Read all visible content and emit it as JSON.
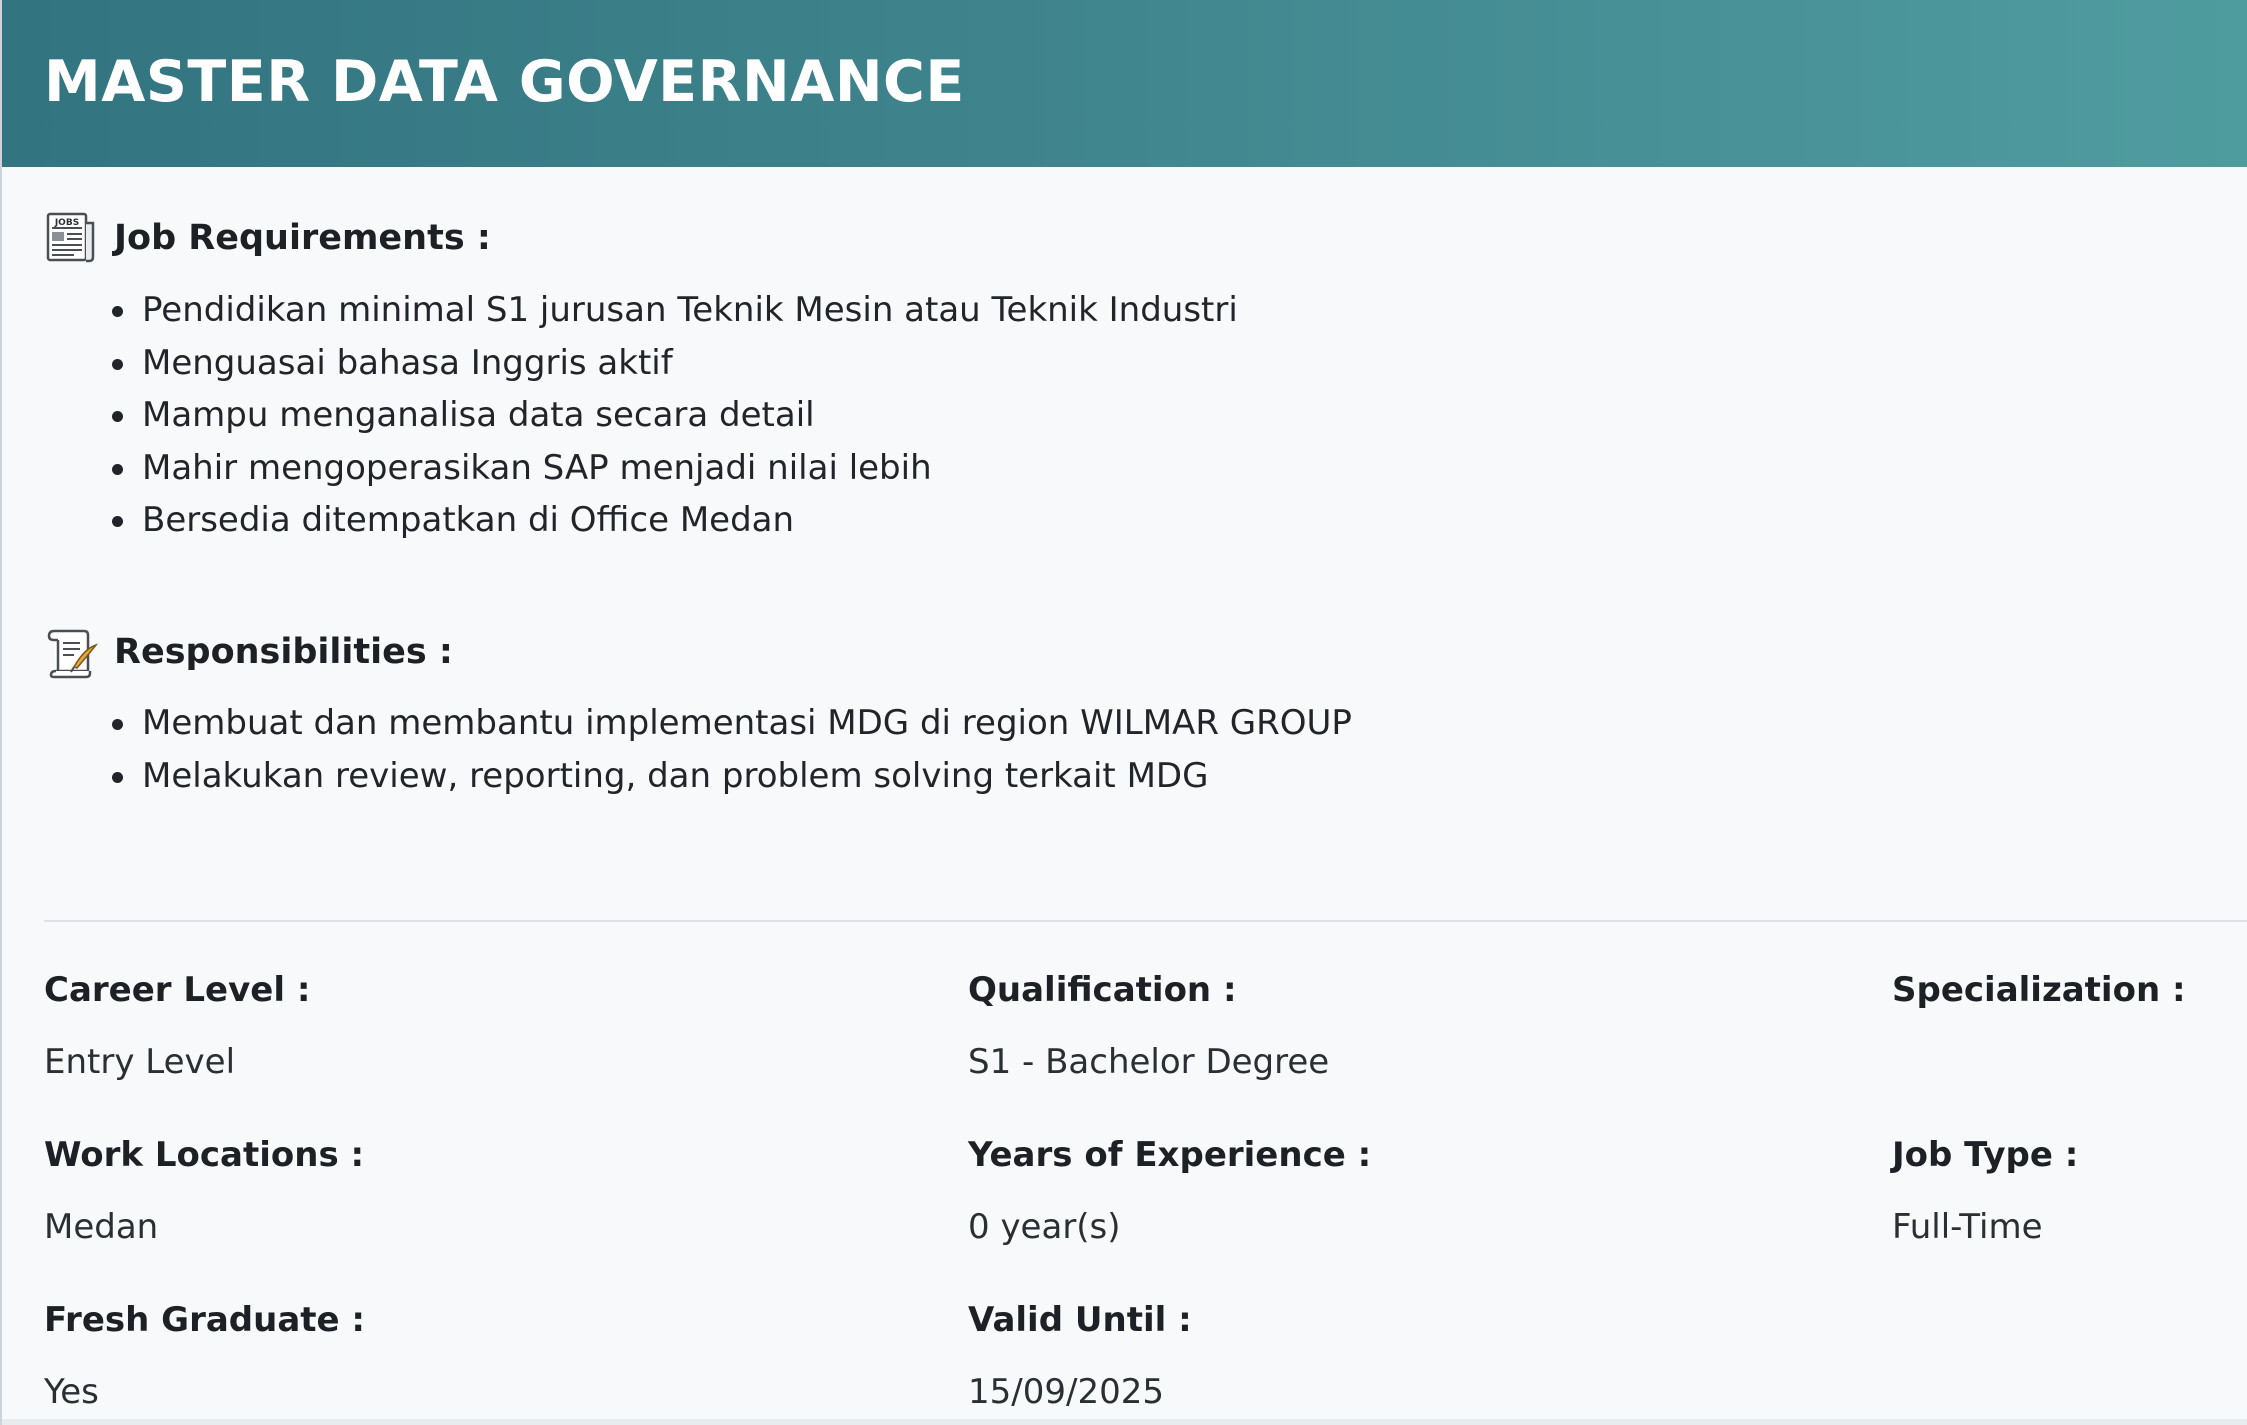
{
  "header": {
    "title": "MASTER DATA GOVERNANCE"
  },
  "job_requirements": {
    "icon": "jobs-newspaper-icon",
    "title": "Job Requirements :",
    "items": [
      "Pendidikan minimal S1 jurusan Teknik Mesin atau Teknik Industri",
      "Menguasai bahasa Inggris aktif",
      "Mampu menganalisa data secara detail",
      "Mahir mengoperasikan SAP menjadi nilai lebih",
      "Bersedia ditempatkan di Office Medan"
    ]
  },
  "responsibilities": {
    "icon": "scroll-quill-icon",
    "title": "Responsibilities :",
    "items": [
      "Membuat dan membantu implementasi MDG di region WILMAR GROUP",
      "Melakukan review, reporting, dan problem solving terkait MDG"
    ]
  },
  "details": {
    "career_level": {
      "label": "Career Level :",
      "value": "Entry Level"
    },
    "qualification": {
      "label": "Qualification :",
      "value": "S1 - Bachelor Degree"
    },
    "specialization": {
      "label": "Specialization :",
      "value": ""
    },
    "work_locations": {
      "label": "Work Locations :",
      "value": "Medan"
    },
    "years_experience": {
      "label": "Years of Experience :",
      "value": "0 year(s)"
    },
    "job_type": {
      "label": "Job Type :",
      "value": "Full-Time"
    },
    "fresh_graduate": {
      "label": "Fresh Graduate :",
      "value": "Yes"
    },
    "valid_until": {
      "label": "Valid Until :",
      "value": "15/09/2025"
    }
  },
  "colors": {
    "header_start": "#327480",
    "header_end": "#4f9c9f",
    "background": "#f8f9fb",
    "text": "#212529"
  }
}
